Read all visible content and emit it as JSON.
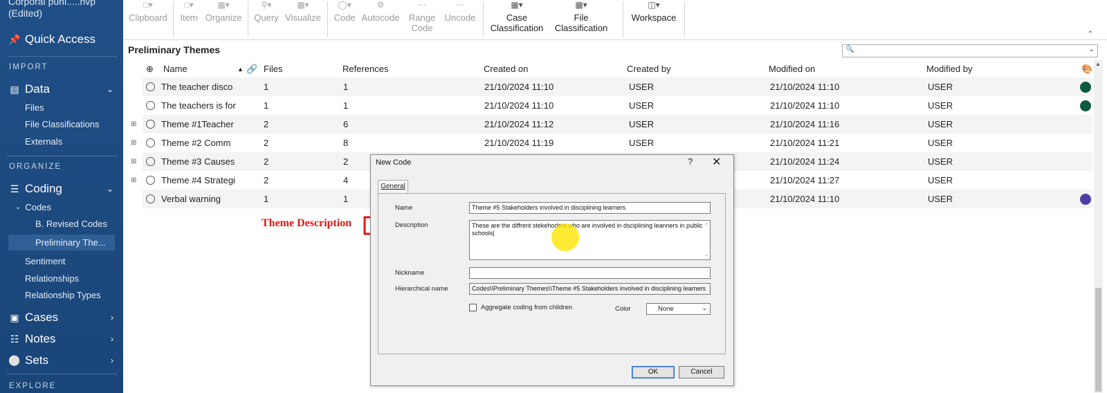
{
  "project": {
    "title_line1": "Corporal puni.....nvp",
    "title_line2": "(Edited)"
  },
  "sidebar": {
    "quick_access": "Quick Access",
    "sections": {
      "import": "IMPORT",
      "organize": "ORGANIZE",
      "explore": "EXPLORE"
    },
    "data": {
      "label": "Data",
      "items": [
        "Files",
        "File Classifications",
        "Externals"
      ]
    },
    "coding": {
      "label": "Coding",
      "codes": "Codes",
      "code_items": [
        "B. Revised Codes",
        "Preliminary The..."
      ],
      "items": [
        "Sentiment",
        "Relationships",
        "Relationship Types"
      ]
    },
    "cases": "Cases",
    "notes": "Notes",
    "sets": "Sets"
  },
  "ribbon": {
    "buttons": [
      {
        "l1": "Clipboard",
        "l2": ""
      },
      {
        "l1": "Item",
        "l2": ""
      },
      {
        "l1": "Organize",
        "l2": ""
      },
      {
        "l1": "Query",
        "l2": ""
      },
      {
        "l1": "Visualize",
        "l2": ""
      },
      {
        "l1": "Code",
        "l2": ""
      },
      {
        "l1": "Autocode",
        "l2": ""
      },
      {
        "l1": "Range",
        "l2": "Code"
      },
      {
        "l1": "Uncode",
        "l2": ""
      },
      {
        "l1": "Case",
        "l2": "Classification"
      },
      {
        "l1": "File",
        "l2": "Classification"
      },
      {
        "l1": "Workspace",
        "l2": ""
      }
    ]
  },
  "list": {
    "title": "Preliminary Themes",
    "search_placeholder": "",
    "columns": [
      "Name",
      "Files",
      "References",
      "Created on",
      "Created by",
      "Modified on",
      "Modified by"
    ],
    "rows": [
      {
        "name": "The teacher disco",
        "files": "1",
        "refs": "1",
        "created_on": "21/10/2024 11:10",
        "created_by": "USER",
        "modified_on": "21/10/2024 11:10",
        "modified_by": "USER",
        "color": "#0e5a3e",
        "expandable": false
      },
      {
        "name": "The teachers is for",
        "files": "1",
        "refs": "1",
        "created_on": "21/10/2024 11:10",
        "created_by": "USER",
        "modified_on": "21/10/2024 11:10",
        "modified_by": "USER",
        "color": "#0e5a3e",
        "expandable": false
      },
      {
        "name": "Theme #1Teacher",
        "files": "2",
        "refs": "6",
        "created_on": "21/10/2024 11:12",
        "created_by": "USER",
        "modified_on": "21/10/2024 11:16",
        "modified_by": "USER",
        "color": "",
        "expandable": true
      },
      {
        "name": "Theme #2  Comm",
        "files": "2",
        "refs": "8",
        "created_on": "21/10/2024 11:19",
        "created_by": "USER",
        "modified_on": "21/10/2024 11:21",
        "modified_by": "USER",
        "color": "",
        "expandable": true
      },
      {
        "name": "Theme #3 Causes",
        "files": "2",
        "refs": "2",
        "created_on": "",
        "created_by": "",
        "modified_on": "21/10/2024 11:24",
        "modified_by": "USER",
        "color": "",
        "expandable": true
      },
      {
        "name": "Theme #4 Strategi",
        "files": "2",
        "refs": "4",
        "created_on": "",
        "created_by": "",
        "modified_on": "21/10/2024 11:27",
        "modified_by": "USER",
        "color": "",
        "expandable": true
      },
      {
        "name": "Verbal warning",
        "files": "1",
        "refs": "1",
        "created_on": "",
        "created_by": "",
        "modified_on": "21/10/2024 11:10",
        "modified_by": "USER",
        "color": "#4b3fa6",
        "expandable": false
      }
    ]
  },
  "annotation": {
    "text": "Theme Description"
  },
  "dialog": {
    "title": "New Code",
    "help": "?",
    "tab": "General",
    "name_label": "Name",
    "name_value": "Theme #5 Stakeholders involved in disciplining learners",
    "description_label": "Description",
    "description_value": "These are the diffrent stekehoders who are involved in dsciplining leanners in public schools|",
    "nickname_label": "Nickname",
    "nickname_value": "",
    "hier_label": "Hierarchical name",
    "hier_value": "Codes\\\\Preliminary Themes\\\\Theme #5 Stakeholders involved in disciplining learners",
    "aggregate_label": "Aggregate coding from children",
    "color_label": "Color",
    "color_value": "None",
    "ok": "OK",
    "cancel": "Cancel"
  },
  "colors": {
    "sidebar": "#1f4f86",
    "annotation": "#e01616",
    "dot_green": "#0e5a3e",
    "dot_purple": "#4b3fa6"
  }
}
